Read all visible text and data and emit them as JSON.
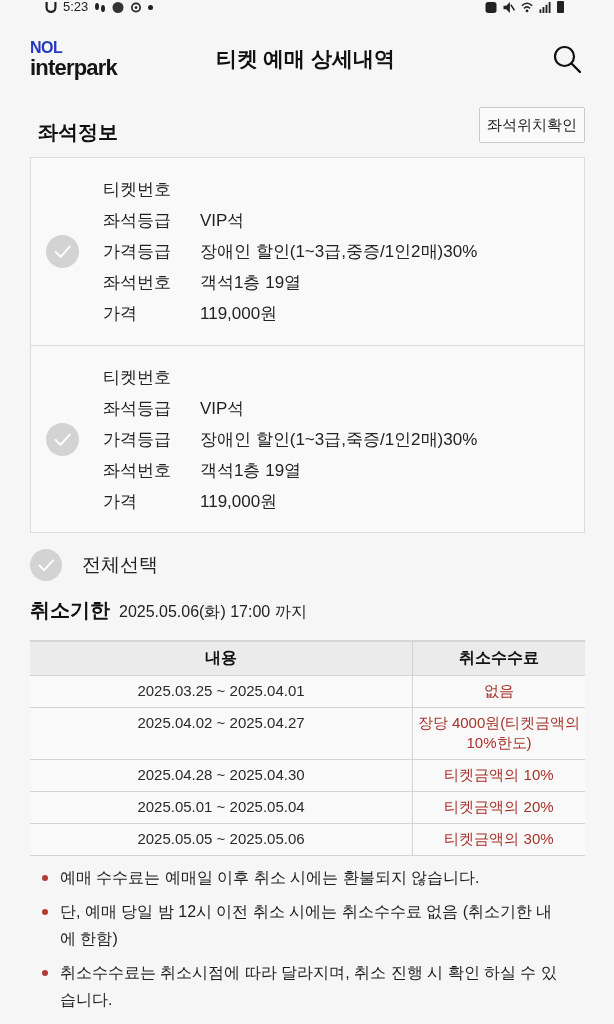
{
  "status_bar": {
    "time": "5:23"
  },
  "header": {
    "logo_top": "NOL",
    "logo_bottom": "interpark",
    "title": "티켓 예매 상세내역"
  },
  "seat_info": {
    "title": "좌석정보",
    "locate_button": "좌석위치확인",
    "tickets": [
      {
        "checked": false,
        "fields": [
          {
            "label": "티켓번호"
          },
          {
            "label": "좌석등급",
            "value": "VIP석"
          },
          {
            "label": "가격등급",
            "value": "장애인 할인(1~3급,중증/1인2매)30%"
          },
          {
            "label": "좌석번호",
            "value": "객석1층 19열"
          },
          {
            "label": "가격",
            "value": "119,000원"
          }
        ]
      },
      {
        "checked": false,
        "fields": [
          {
            "label": "티켓번호"
          },
          {
            "label": "좌석등급",
            "value": "VIP석"
          },
          {
            "label": "가격등급",
            "value": "장애인 할인(1~3급,죽증/1인2매)30%"
          },
          {
            "label": "좌석번호",
            "value": "객석1층 19열"
          },
          {
            "label": "가격",
            "value": "119,000원"
          }
        ]
      }
    ]
  },
  "select_all": {
    "label": "전체선택",
    "checked": false
  },
  "cancel_deadline": {
    "title": "취소기한",
    "date": "2025.05.06(화) 17:00 까지"
  },
  "fee_table": {
    "columns": [
      "내용",
      "취소수수료"
    ],
    "rows": [
      {
        "period": "2025.03.25 ~ 2025.04.01",
        "fee": "없음"
      },
      {
        "period": "2025.04.02 ~ 2025.04.27",
        "fee": "장당 4000원(티켓금액의 10%한도)"
      },
      {
        "period": "2025.04.28 ~ 2025.04.30",
        "fee": "티켓금액의 10%"
      },
      {
        "period": "2025.05.01 ~ 2025.05.04",
        "fee": "티켓금액의 20%"
      },
      {
        "period": "2025.05.05 ~ 2025.05.06",
        "fee": "티켓금액의 30%"
      }
    ]
  },
  "notes": [
    "예매 수수료는 예매일 이후 취소 시에는 환불되지 않습니다.",
    "단, 예매 당일 밤 12시 이전 취소 시에는 취소수수료 없음 (취소기한 내에 한함)",
    "취소수수료는 취소시점에 따라 달라지며, 취소 진행 시 확인 하실 수 있습니다."
  ]
}
